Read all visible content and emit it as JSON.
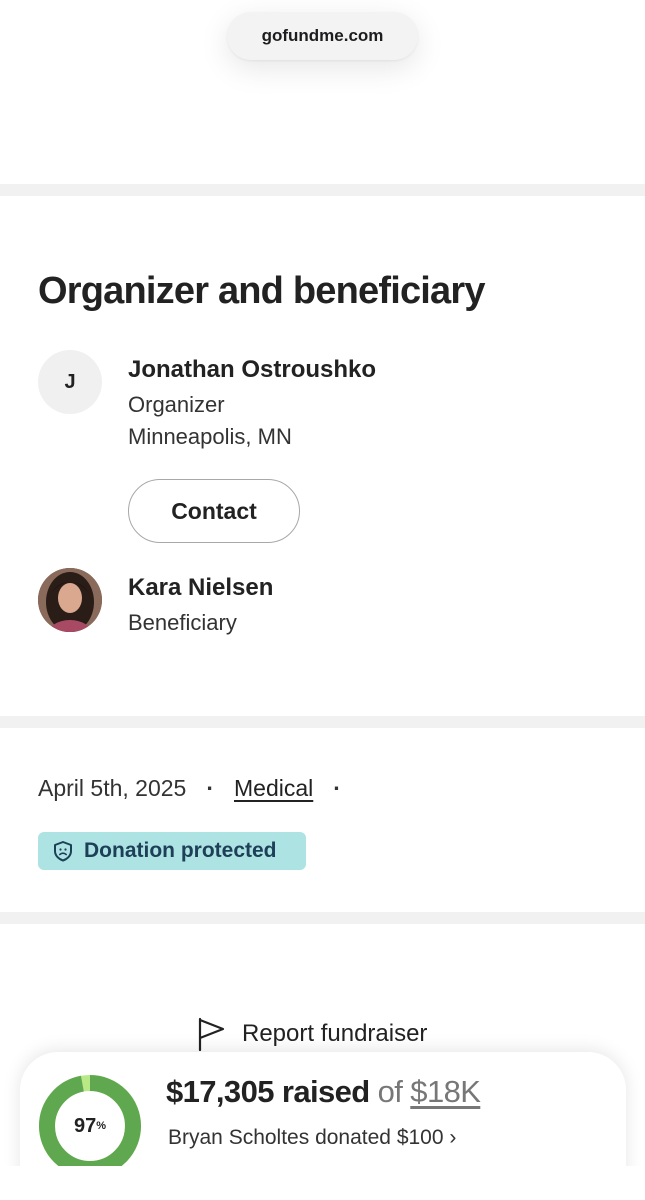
{
  "browser": {
    "url": "gofundme.com"
  },
  "organizer_section": {
    "title": "Organizer and beneficiary",
    "organizer": {
      "initial": "J",
      "name": "Jonathan Ostroushko",
      "role": "Organizer",
      "location": "Minneapolis, MN",
      "contact_label": "Contact"
    },
    "beneficiary": {
      "name": "Kara Nielsen",
      "role": "Beneficiary"
    }
  },
  "meta": {
    "date": "April 5th, 2025",
    "category": "Medical",
    "separator": "·",
    "badge_label": "Donation protected",
    "badge_icon": "shield-icon"
  },
  "report": {
    "label": "Report fundraiser",
    "icon": "flag-icon"
  },
  "progress": {
    "percent_value": 0.97,
    "percent_number": "97",
    "percent_sign": "%",
    "raised_amount": "$17,305 raised",
    "of_text": "of",
    "goal": "$18K",
    "recent_donation": "Bryan Scholtes donated $100",
    "chevron": "›"
  },
  "colors": {
    "badge_bg": "#aee3e3",
    "badge_text": "#1d3f57",
    "progress_dark": "#5fa84f",
    "progress_light": "#b8e986"
  }
}
